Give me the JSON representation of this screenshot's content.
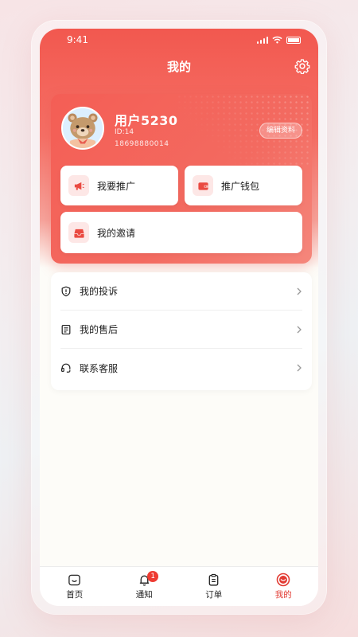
{
  "status_bar": {
    "time": "9:41"
  },
  "nav": {
    "title": "我的"
  },
  "profile": {
    "name": "用户5230",
    "id": "ID:14",
    "phone": "18698880014",
    "edit_label": "编辑资料"
  },
  "actions": {
    "promote_label": "我要推广",
    "wallet_label": "推广钱包",
    "invite_label": "我的邀请"
  },
  "menu": {
    "items": [
      {
        "label": "我的投诉",
        "icon": "shield-alert-icon"
      },
      {
        "label": "我的售后",
        "icon": "document-icon"
      },
      {
        "label": "联系客服",
        "icon": "headset-icon"
      }
    ]
  },
  "tabbar": {
    "tabs": [
      {
        "label": "首页",
        "icon": "home-icon"
      },
      {
        "label": "通知",
        "icon": "bell-icon",
        "badge": "1"
      },
      {
        "label": "订单",
        "icon": "clipboard-icon"
      },
      {
        "label": "我的",
        "icon": "profile-icon",
        "active": true
      }
    ]
  },
  "colors": {
    "accent": "#F2584F",
    "active_tab": "#E23B33",
    "badge": "#EE3B32"
  }
}
